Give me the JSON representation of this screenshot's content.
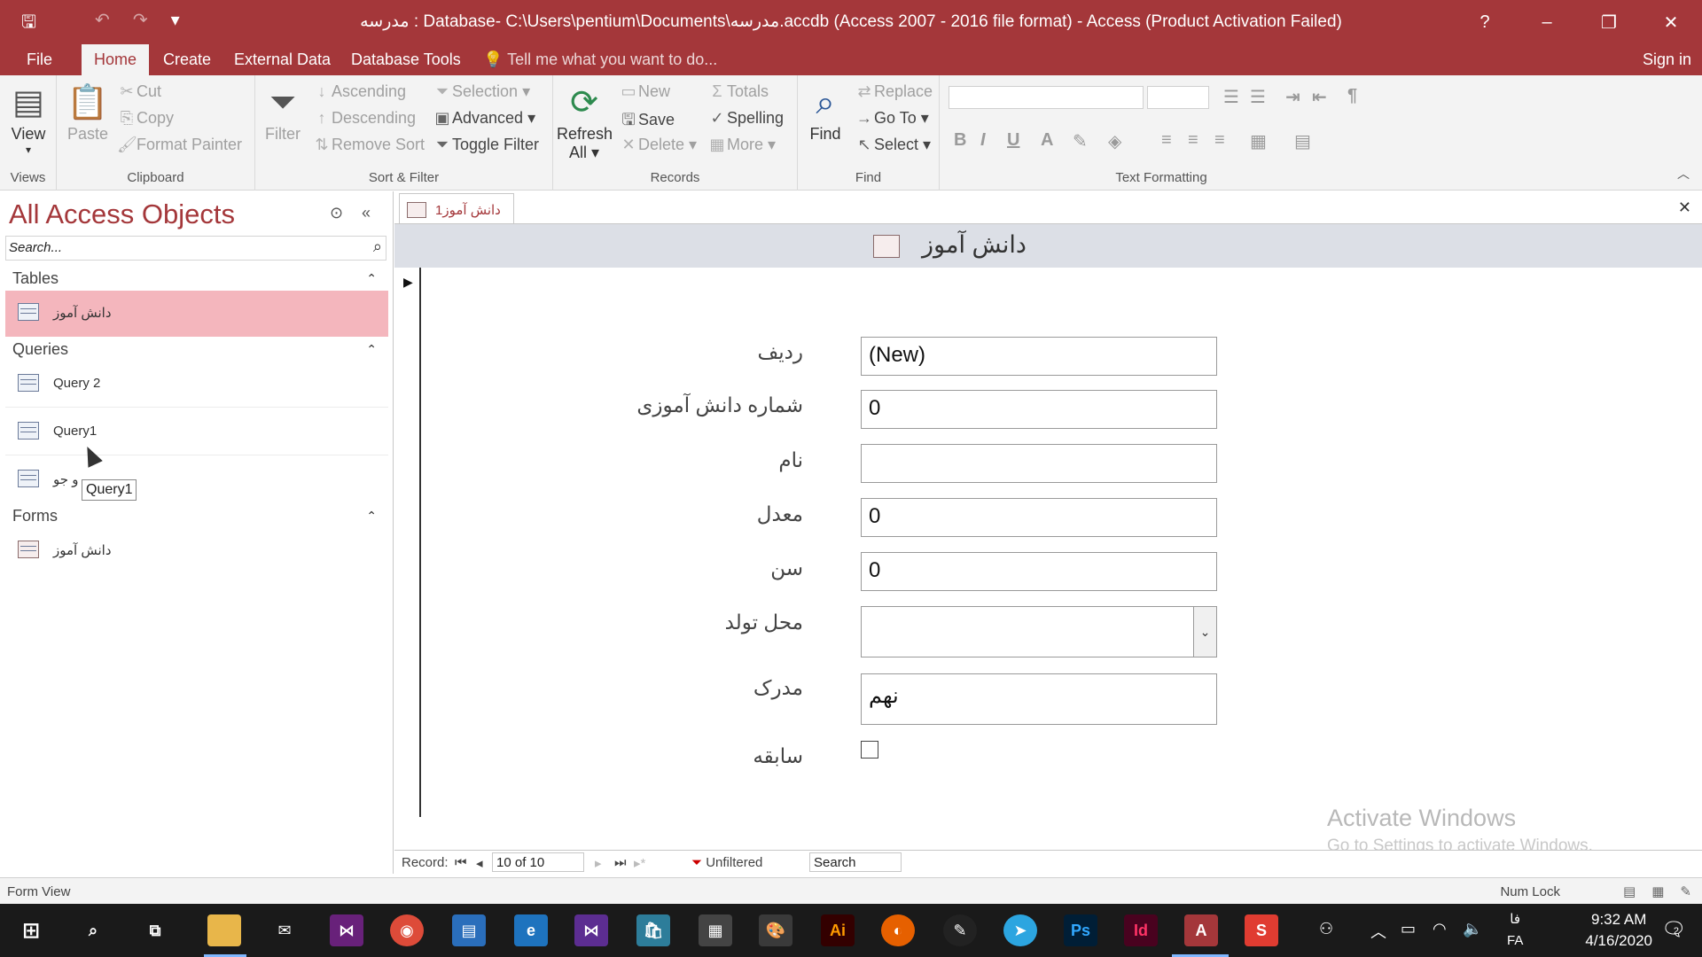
{
  "window": {
    "title": "مدرسه : Database- C:\\Users\\pentium\\Documents\\مدرسه.accdb (Access 2007 - 2016 file format) - Access (Product Activation Failed)",
    "help": "?",
    "minimize": "–",
    "restore": "❐",
    "close": "✕"
  },
  "qat": {
    "save": "🖫",
    "undo": "↶",
    "redo": "↷",
    "customize": "▾"
  },
  "ribbon_tabs": {
    "file": "File",
    "home": "Home",
    "create": "Create",
    "external": "External Data",
    "dbtools": "Database Tools",
    "tell": "Tell me what you want to do...",
    "signin": "Sign in"
  },
  "ribbon": {
    "views": {
      "view": "View",
      "label": "Views"
    },
    "clipboard": {
      "paste": "Paste",
      "cut": "Cut",
      "copy": "Copy",
      "format_painter": "Format Painter",
      "label": "Clipboard"
    },
    "sortfilter": {
      "filter": "Filter",
      "ascending": "Ascending",
      "descending": "Descending",
      "remove_sort": "Remove Sort",
      "selection": "Selection",
      "advanced": "Advanced",
      "toggle_filter": "Toggle Filter",
      "label": "Sort & Filter"
    },
    "records": {
      "refresh": "Refresh",
      "refresh2": "All",
      "new": "New",
      "save": "Save",
      "delete": "Delete",
      "totals": "Totals",
      "spelling": "Spelling",
      "more": "More",
      "label": "Records"
    },
    "find": {
      "find": "Find",
      "replace": "Replace",
      "goto": "Go To",
      "select": "Select",
      "label": "Find"
    },
    "textformatting": {
      "label": "Text Formatting",
      "bold": "B",
      "italic": "I",
      "underline": "U",
      "fontcolor": "A"
    }
  },
  "nav": {
    "title": "All Access Objects",
    "search_placeholder": "Search...",
    "categories": {
      "tables": "Tables",
      "queries": "Queries",
      "forms": "Forms"
    },
    "tables": [
      "دانش آموز"
    ],
    "queries": [
      "Query 2",
      "Query1",
      "و جو"
    ],
    "forms": [
      "دانش آموز"
    ],
    "tooltip": "Query1"
  },
  "doc": {
    "tab_label": "دانش آموز1",
    "form_title": "دانش آموز",
    "fields": [
      {
        "label": "ردیف",
        "value": "(New)"
      },
      {
        "label": "شماره دانش آموزی",
        "value": "0"
      },
      {
        "label": "نام",
        "value": ""
      },
      {
        "label": "معدل",
        "value": "0"
      },
      {
        "label": "سن",
        "value": "0"
      },
      {
        "label": "محل تولد",
        "value": ""
      },
      {
        "label": "مدرک",
        "value": "نهم"
      },
      {
        "label": "سابقه",
        "value": ""
      }
    ],
    "activate_title": "Activate Windows",
    "activate_sub": "Go to Settings to activate Windows."
  },
  "record_nav": {
    "label": "Record:",
    "position": "10 of 10",
    "filter": "Unfiltered",
    "search": "Search"
  },
  "status": {
    "left": "Form View",
    "numlock": "Num Lock"
  },
  "taskbar": {
    "lang1": "فا",
    "lang2": "FA",
    "time": "9:32 AM",
    "date": "4/16/2020",
    "notifications": "2",
    "apps": [
      "Files",
      "Mail",
      "VS",
      "Chrome",
      "Explorer",
      "Edge",
      "VS Code",
      "Store",
      "Calc",
      "Paint",
      "Ai",
      "Firefox",
      "Pen",
      "Telegram",
      "Ps",
      "Id",
      "A",
      "S"
    ]
  },
  "colors": {
    "accent": "#a4373a",
    "selected_item": "#f4b6bd"
  }
}
